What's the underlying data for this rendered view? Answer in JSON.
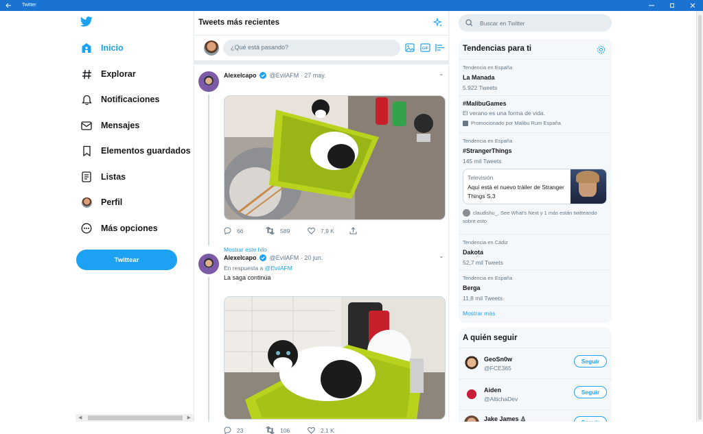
{
  "window": {
    "title": "Twitter"
  },
  "nav": {
    "items": [
      {
        "label": "Inicio"
      },
      {
        "label": "Explorar"
      },
      {
        "label": "Notificaciones"
      },
      {
        "label": "Mensajes"
      },
      {
        "label": "Elementos guardados"
      },
      {
        "label": "Listas"
      },
      {
        "label": "Perfil"
      },
      {
        "label": "Más opciones"
      }
    ],
    "tweet_button": "Twittear",
    "accent": "#1da1f2"
  },
  "timeline": {
    "title": "Tweets más recientes",
    "compose_placeholder": "¿Qué está pasando?",
    "tweets": [
      {
        "name": "Alexelcapo",
        "handle": "@EvilAFM",
        "time": "· 27 may.",
        "replies": "66",
        "retweets": "589",
        "likes": "7,9 K",
        "thread_link": "Mostrar este hilo"
      },
      {
        "name": "Alexelcapo",
        "handle": "@EvilAFM",
        "time": "· 20 jun.",
        "reply_prefix": "En respuesta a",
        "reply_to": "@EvilAFM",
        "text": "La saga continúa",
        "replies": "23",
        "retweets": "106",
        "likes": "2,1 K"
      }
    ]
  },
  "search": {
    "placeholder": "Buscar en Twitter"
  },
  "trends": {
    "title": "Tendencias para ti",
    "items": [
      {
        "context": "Tendencia en España",
        "name": "La Manada",
        "count": "5.922 Tweets"
      },
      {
        "context": "",
        "name": "#MalibuGames",
        "description": "El verano es una forma de vida.",
        "promoted": "Promocionado por Malibu Rum España"
      },
      {
        "context": "Tendencia en España",
        "name": "#StrangerThings",
        "count": "145 mil Tweets",
        "card": {
          "category": "Televisión",
          "text": "Aquí está el nuevo tráiler de Stranger Things S.3"
        },
        "social": "claudishu_, See What's Next y 1 más están twitteando sobre esto"
      },
      {
        "context": "Tendencia en Cádiz",
        "name": "Dakota",
        "count": "52,7 mil Tweets"
      },
      {
        "context": "Tendencia en España",
        "name": "Berga",
        "count": "11,8 mil Tweets"
      }
    ],
    "show_more": "Mostrar más"
  },
  "who_to_follow": {
    "title": "A quién seguir",
    "follow_label": "Seguir",
    "users": [
      {
        "name": "GeoSn0w",
        "handle": "@FCE365"
      },
      {
        "name": "Aiden",
        "handle": "@AltichaDev"
      },
      {
        "name": "Jake James ♙",
        "handle": ""
      }
    ]
  }
}
